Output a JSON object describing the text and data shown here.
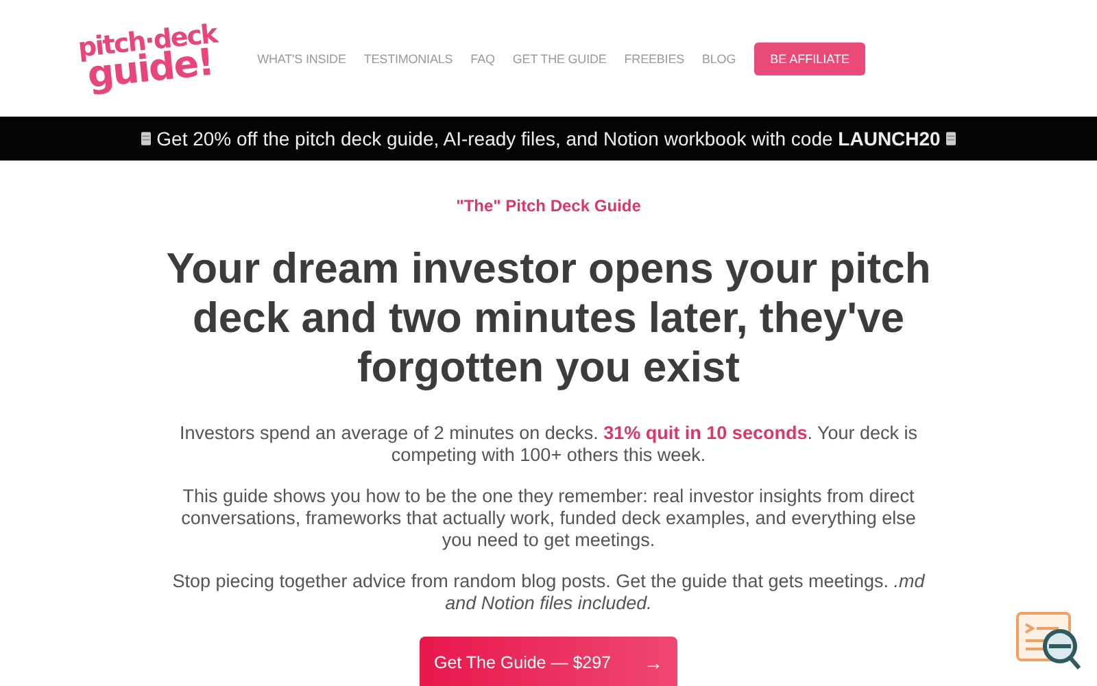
{
  "logo": {
    "lines": [
      "pitch·deck",
      "guide!"
    ]
  },
  "nav": {
    "links": [
      "WHAT'S INSIDE",
      "TESTIMONIALS",
      "FAQ",
      "GET THE GUIDE",
      "FREEBIES",
      "BLOG"
    ],
    "cta": "BE AFFILIATE"
  },
  "banner": {
    "text": "Get 20% off the pitch deck guide, AI-ready files, and Notion workbook with code **LAUNCH20**"
  },
  "hero": {
    "eyebrow": "\"The\" Pitch Deck Guide",
    "title": "Your dream investor opens your pitch deck and two minutes later, they've forgotten you exist",
    "paragraphs": [
      "Investors spend an average of 2 minutes on decks. **31% quit in 10 seconds**. Your deck is competing with 100+ others this week.",
      "This guide shows you how to be the one they remember: real investor insights from direct conversations, frameworks that actually work, funded deck examples, and everything else you need to get meetings.",
      "Stop piecing together advice from random blog posts. Get the guide that gets meetings. *.md and Notion files included.*"
    ],
    "button": "Get The Guide — $297",
    "button_arrow": "→"
  }
}
